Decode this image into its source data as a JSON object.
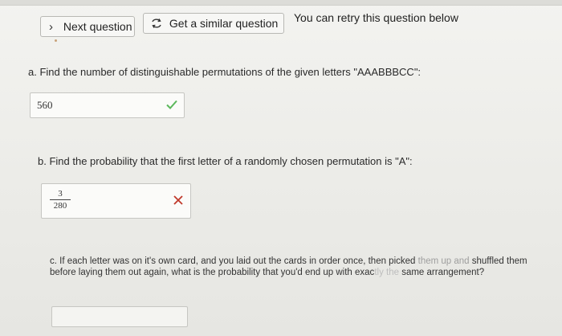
{
  "toolbar": {
    "next_label": "Next question",
    "similar_label": "Get a similar question",
    "retry_note": "You can retry this question below"
  },
  "question_a": {
    "prompt": "a. Find the number of distinguishable permutations of the given letters \"AAABBBCC\":",
    "answer": "560",
    "status": "correct"
  },
  "question_b": {
    "prompt": "b. Find the probability that the first letter of a randomly chosen permutation is \"A\":",
    "answer_numerator": "3",
    "answer_denominator": "280",
    "status": "incorrect"
  },
  "question_c": {
    "prompt_main": "c. If each letter was on it's own card, and you laid out the cards in order once, then picked ",
    "prompt_fade1": "them up and",
    "prompt_line2": " shuffled them before laying them out again, what is the probability that you'd end up with exac",
    "prompt_fade2": "tly the",
    "prompt_line3": " same arrangement?",
    "answer": ""
  },
  "colors": {
    "check_green": "#5cb85c",
    "cross_red": "#c0392b"
  },
  "icons": {
    "next": "chevron-right-icon",
    "similar": "retry-arrows-icon",
    "correct": "checkmark-icon",
    "incorrect": "close-icon"
  }
}
